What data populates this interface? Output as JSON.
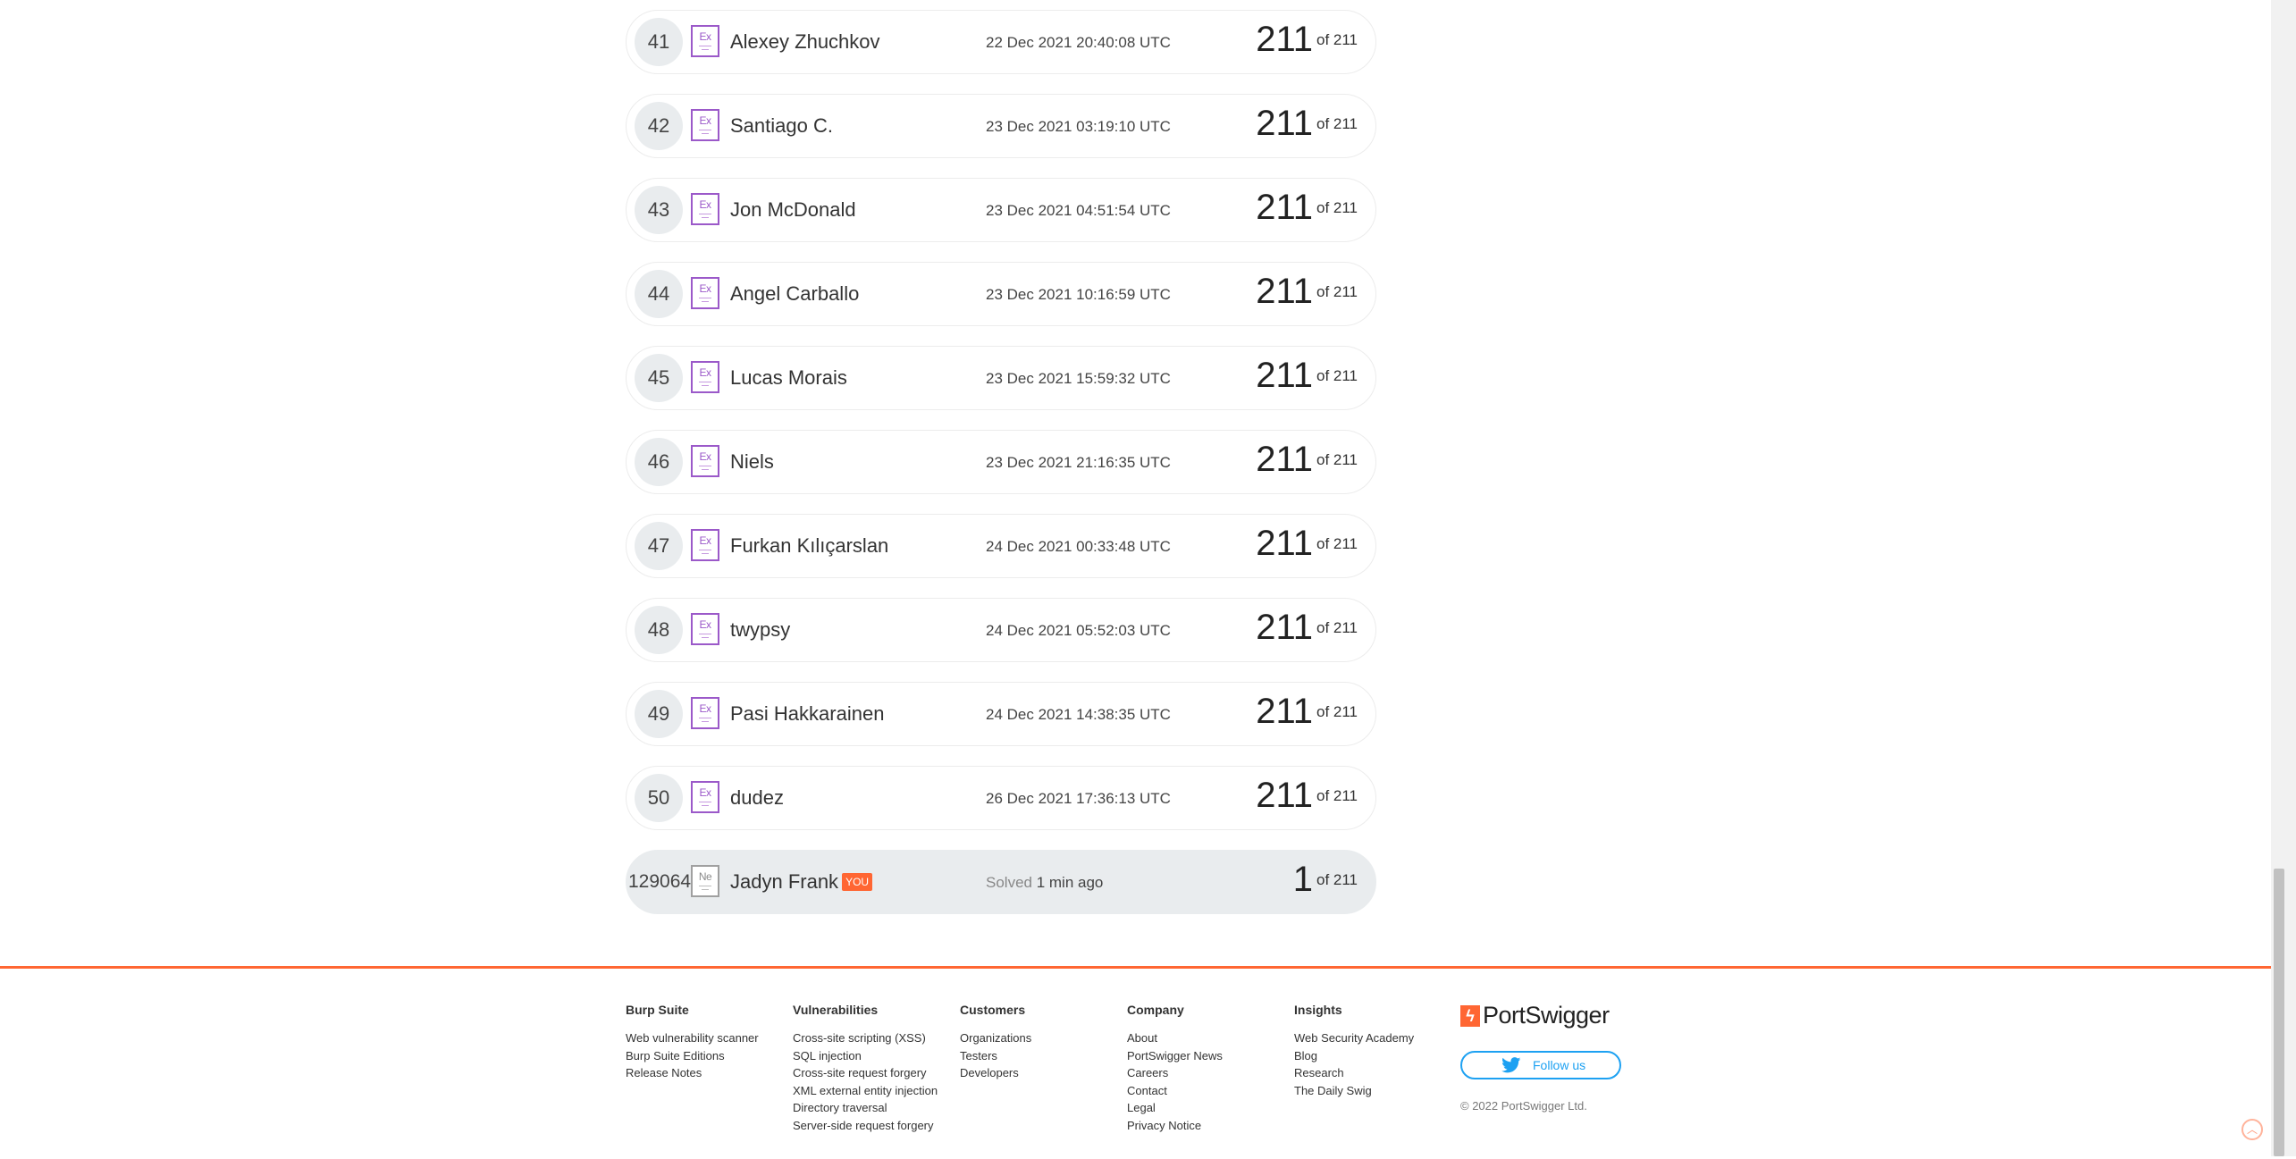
{
  "leaderboard": {
    "rows": [
      {
        "rank": "41",
        "badge": "Ex",
        "name": "Alexey Zhuchkov",
        "time": "22 Dec 2021 20:40:08 UTC",
        "score": "211",
        "total": "of 211"
      },
      {
        "rank": "42",
        "badge": "Ex",
        "name": "Santiago C.",
        "time": "23 Dec 2021 03:19:10 UTC",
        "score": "211",
        "total": "of 211"
      },
      {
        "rank": "43",
        "badge": "Ex",
        "name": "Jon McDonald",
        "time": "23 Dec 2021 04:51:54 UTC",
        "score": "211",
        "total": "of 211"
      },
      {
        "rank": "44",
        "badge": "Ex",
        "name": "Angel Carballo",
        "time": "23 Dec 2021 10:16:59 UTC",
        "score": "211",
        "total": "of 211"
      },
      {
        "rank": "45",
        "badge": "Ex",
        "name": "Lucas Morais",
        "time": "23 Dec 2021 15:59:32 UTC",
        "score": "211",
        "total": "of 211"
      },
      {
        "rank": "46",
        "badge": "Ex",
        "name": "Niels",
        "time": "23 Dec 2021 21:16:35 UTC",
        "score": "211",
        "total": "of 211"
      },
      {
        "rank": "47",
        "badge": "Ex",
        "name": "Furkan Kılıçarslan",
        "time": "24 Dec 2021 00:33:48 UTC",
        "score": "211",
        "total": "of 211"
      },
      {
        "rank": "48",
        "badge": "Ex",
        "name": "twypsy",
        "time": "24 Dec 2021 05:52:03 UTC",
        "score": "211",
        "total": "of 211"
      },
      {
        "rank": "49",
        "badge": "Ex",
        "name": "Pasi Hakkarainen",
        "time": "24 Dec 2021 14:38:35 UTC",
        "score": "211",
        "total": "of 211"
      },
      {
        "rank": "50",
        "badge": "Ex",
        "name": "dudez",
        "time": "26 Dec 2021 17:36:13 UTC",
        "score": "211",
        "total": "of 211"
      }
    ],
    "current_user": {
      "rank": "129064",
      "badge": "Ne",
      "name": "Jadyn Frank",
      "you_label": "YOU",
      "solved_label": "Solved",
      "solved_ago": "1 min ago",
      "score": "1",
      "total": "of 211"
    }
  },
  "footer": {
    "columns": [
      {
        "title": "Burp Suite",
        "links": [
          "Web vulnerability scanner",
          "Burp Suite Editions",
          "Release Notes"
        ]
      },
      {
        "title": "Vulnerabilities",
        "links": [
          "Cross-site scripting (XSS)",
          "SQL injection",
          "Cross-site request forgery",
          "XML external entity injection",
          "Directory traversal",
          "Server-side request forgery"
        ]
      },
      {
        "title": "Customers",
        "links": [
          "Organizations",
          "Testers",
          "Developers"
        ]
      },
      {
        "title": "Company",
        "links": [
          "About",
          "PortSwigger News",
          "Careers",
          "Contact",
          "Legal",
          "Privacy Notice"
        ]
      },
      {
        "title": "Insights",
        "links": [
          "Web Security Academy",
          "Blog",
          "Research",
          "The Daily Swig"
        ]
      }
    ],
    "logo_text": "PortSwigger",
    "follow_label": "Follow us",
    "copyright": "© 2022 PortSwigger Ltd."
  },
  "colors": {
    "accent": "#ff6633",
    "expert_badge": "#9b59c9",
    "twitter": "#1da1f2"
  },
  "icons": {
    "badge": "expert-badge-icon",
    "twitter": "twitter-bird-icon",
    "back_to_top": "chevron-up-icon"
  }
}
